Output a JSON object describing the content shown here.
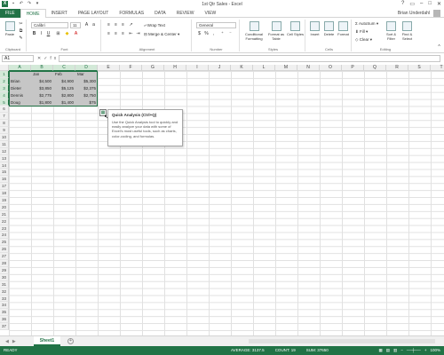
{
  "window": {
    "title": "1st Qtr Sales - Excel",
    "user": "Brian Underdahl"
  },
  "ribbon": {
    "tabs": [
      "FILE",
      "HOME",
      "INSERT",
      "PAGE LAYOUT",
      "FORMULAS",
      "DATA",
      "REVIEW",
      "VIEW"
    ],
    "active_tab": "HOME",
    "font_name": "Calibri",
    "font_size": "11",
    "number_format": "General",
    "wrap_text": "Wrap Text",
    "merge_center": "Merge & Center",
    "paste": "Paste",
    "conditional_formatting": "Conditional Formatting",
    "format_as_table": "Format as Table",
    "cell_styles": "Cell Styles",
    "insert": "Insert",
    "delete": "Delete",
    "format": "Format",
    "autosum": "AutoSum",
    "fill": "Fill",
    "clear": "Clear",
    "sort_filter": "Sort & Filter",
    "find_select": "Find & Select",
    "groups": {
      "clipboard": "Clipboard",
      "font": "Font",
      "alignment": "Alignment",
      "number": "Number",
      "styles": "Styles",
      "cells": "Cells",
      "editing": "Editing"
    }
  },
  "formula_bar": {
    "name_box": "A1",
    "fx": "fx"
  },
  "columns": [
    "A",
    "B",
    "C",
    "D",
    "E",
    "F",
    "G",
    "H",
    "I",
    "J",
    "K",
    "L",
    "M",
    "N",
    "O",
    "P",
    "Q",
    "R",
    "S",
    "T"
  ],
  "rows": [
    "1",
    "2",
    "3",
    "4",
    "5",
    "6",
    "7",
    "8",
    "9",
    "10",
    "11",
    "12",
    "13",
    "14",
    "15",
    "16",
    "17",
    "18",
    "19",
    "20",
    "21",
    "22",
    "23",
    "24",
    "25",
    "26",
    "27",
    "28",
    "29",
    "30",
    "31",
    "32",
    "33",
    "34",
    "35",
    "36",
    "37"
  ],
  "table": {
    "header": [
      "",
      "Jan",
      "Feb",
      "Mar"
    ],
    "rows": [
      [
        "Brian",
        "$4,500",
        "$4,900",
        "$5,300"
      ],
      [
        "Dieter",
        "$3,850",
        "$5,125",
        "$2,375"
      ],
      [
        "Dennis",
        "$2,775",
        "$2,800",
        "$2,750"
      ],
      [
        "Doug",
        "$1,800",
        "$1,400",
        "$75"
      ]
    ]
  },
  "tooltip": {
    "title": "Quick Analysis (Ctrl+Q)",
    "body": "Use the Quick Analysis tool to quickly and easily analyze your data with some of Excel's most useful tools, such as charts, color-coding, and formulas."
  },
  "sheets": {
    "active": "Sheet1"
  },
  "status": {
    "mode": "READY",
    "average": "AVERAGE: 3137.5",
    "count": "COUNT: 19",
    "sum": "SUM: 37650",
    "zoom": "100%"
  },
  "colors": {
    "accent": "#217346",
    "selection": "#c6c6c6"
  }
}
